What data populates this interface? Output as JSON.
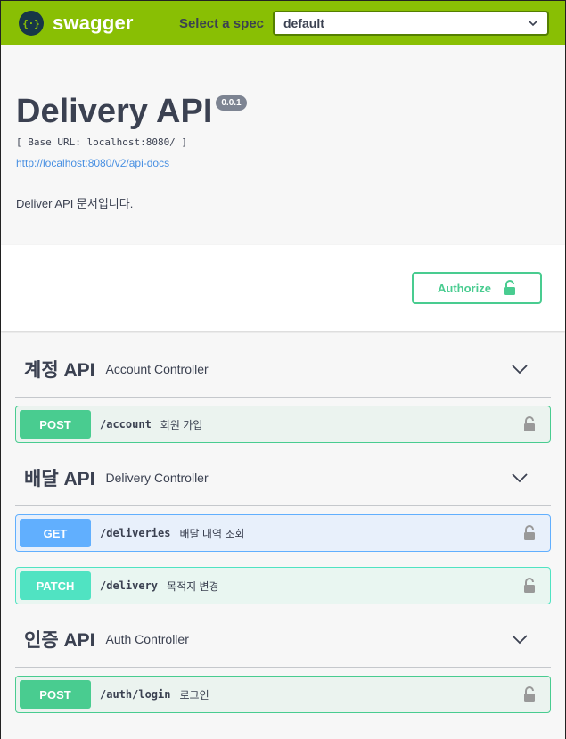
{
  "topbar": {
    "brand": "swagger",
    "spec_label": "Select a spec",
    "spec_value": "default"
  },
  "info": {
    "title": "Delivery API",
    "version": "0.0.1",
    "base_url": "[ Base URL: localhost:8080/ ]",
    "docs_link": "http://localhost:8080/v2/api-docs",
    "description": "Deliver API 문서입니다."
  },
  "auth": {
    "authorize_label": "Authorize"
  },
  "tags": [
    {
      "name": "계정 API",
      "description": "Account Controller",
      "operations": [
        {
          "method": "POST",
          "path": "/account",
          "summary": "회원 가입"
        }
      ]
    },
    {
      "name": "배달 API",
      "description": "Delivery Controller",
      "operations": [
        {
          "method": "GET",
          "path": "/deliveries",
          "summary": "배달 내역 조회"
        },
        {
          "method": "PATCH",
          "path": "/delivery",
          "summary": "목적지 변경"
        }
      ]
    },
    {
      "name": "인증 API",
      "description": "Auth Controller",
      "operations": [
        {
          "method": "POST",
          "path": "/auth/login",
          "summary": "로그인"
        }
      ]
    }
  ],
  "colors": {
    "topbar": "#89bf04",
    "post": "#49cc90",
    "get": "#61affe",
    "patch": "#50e3c2",
    "text": "#3b4151"
  }
}
